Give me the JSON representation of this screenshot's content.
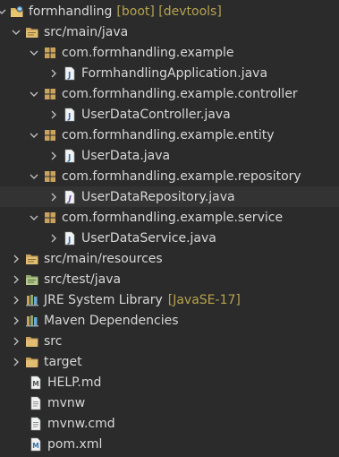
{
  "colors": {
    "background": "#2b2b2b",
    "text": "#d7d7d7",
    "decoration": "#b5a24f",
    "package_icon": "#c9a25d"
  },
  "tree": {
    "project": {
      "label": "formhandling",
      "decoration": "[boot] [devtools]",
      "icon": "project-icon"
    },
    "src_main_java": {
      "label": "src/main/java",
      "icon": "source-folder-icon"
    },
    "pkg_example": {
      "label": "com.formhandling.example",
      "icon": "package-icon"
    },
    "file_application": {
      "label": "FormhandlingApplication.java",
      "icon": "java-file-icon"
    },
    "pkg_controller": {
      "label": "com.formhandling.example.controller",
      "icon": "package-icon"
    },
    "file_controller": {
      "label": "UserDataController.java",
      "icon": "java-file-icon"
    },
    "pkg_entity": {
      "label": "com.formhandling.example.entity",
      "icon": "package-icon"
    },
    "file_entity": {
      "label": "UserData.java",
      "icon": "java-file-icon"
    },
    "pkg_repository": {
      "label": "com.formhandling.example.repository",
      "icon": "package-icon"
    },
    "file_repository": {
      "label": "UserDataRepository.java",
      "icon": "java-interface-icon"
    },
    "pkg_service": {
      "label": "com.formhandling.example.service",
      "icon": "package-icon"
    },
    "file_service": {
      "label": "UserDataService.java",
      "icon": "java-file-icon"
    },
    "src_main_resources": {
      "label": "src/main/resources",
      "icon": "source-folder-icon"
    },
    "src_test_java": {
      "label": "src/test/java",
      "icon": "source-folder-icon"
    },
    "jre_library": {
      "label": "JRE System Library",
      "decoration": "[JavaSE-17]",
      "icon": "library-icon"
    },
    "maven_deps": {
      "label": "Maven Dependencies",
      "icon": "library-icon"
    },
    "folder_src": {
      "label": "src",
      "icon": "folder-icon"
    },
    "folder_target": {
      "label": "target",
      "icon": "folder-icon"
    },
    "file_help": {
      "label": "HELP.md",
      "icon": "markdown-file-icon"
    },
    "file_mvnw": {
      "label": "mvnw",
      "icon": "text-file-icon"
    },
    "file_mvnw_cmd": {
      "label": "mvnw.cmd",
      "icon": "text-file-icon"
    },
    "file_pom": {
      "label": "pom.xml",
      "icon": "maven-pom-icon"
    }
  }
}
